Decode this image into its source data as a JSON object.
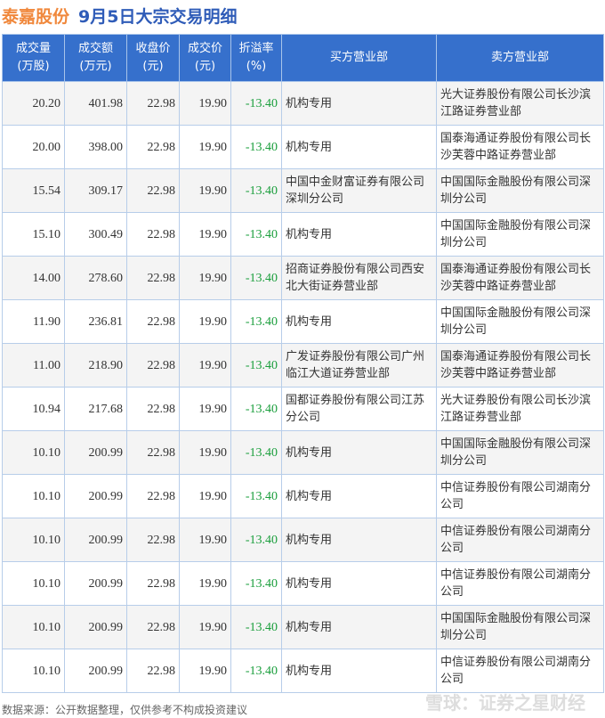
{
  "title": {
    "stock": "泰嘉股份",
    "desc": "9月5日大宗交易明细"
  },
  "headers": [
    "成交量\n(万股)",
    "成交额\n(万元)",
    "收盘价\n(元)",
    "成交价\n(元)",
    "折溢率\n(%)",
    "买方营业部",
    "卖方营业部"
  ],
  "colors": {
    "header": "#3670cc",
    "discount": "#1a9e3c",
    "stock": "#f0883c",
    "title": "#2f5cb8"
  },
  "rows": [
    [
      "20.20",
      "401.98",
      "22.98",
      "19.90",
      "-13.40",
      "机构专用",
      "光大证券股份有限公司长沙滨江路证券营业部"
    ],
    [
      "20.00",
      "398.00",
      "22.98",
      "19.90",
      "-13.40",
      "机构专用",
      "国泰海通证券股份有限公司长沙芙蓉中路证券营业部"
    ],
    [
      "15.54",
      "309.17",
      "22.98",
      "19.90",
      "-13.40",
      "中国中金财富证券有限公司深圳分公司",
      "中国国际金融股份有限公司深圳分公司"
    ],
    [
      "15.10",
      "300.49",
      "22.98",
      "19.90",
      "-13.40",
      "机构专用",
      "中国国际金融股份有限公司深圳分公司"
    ],
    [
      "14.00",
      "278.60",
      "22.98",
      "19.90",
      "-13.40",
      "招商证券股份有限公司西安北大街证券营业部",
      "国泰海通证券股份有限公司长沙芙蓉中路证券营业部"
    ],
    [
      "11.90",
      "236.81",
      "22.98",
      "19.90",
      "-13.40",
      "机构专用",
      "中国国际金融股份有限公司深圳分公司"
    ],
    [
      "11.00",
      "218.90",
      "22.98",
      "19.90",
      "-13.40",
      "广发证券股份有限公司广州临江大道证券营业部",
      "国泰海通证券股份有限公司长沙芙蓉中路证券营业部"
    ],
    [
      "10.94",
      "217.68",
      "22.98",
      "19.90",
      "-13.40",
      "国都证券股份有限公司江苏分公司",
      "光大证券股份有限公司长沙滨江路证券营业部"
    ],
    [
      "10.10",
      "200.99",
      "22.98",
      "19.90",
      "-13.40",
      "机构专用",
      "中国国际金融股份有限公司深圳分公司"
    ],
    [
      "10.10",
      "200.99",
      "22.98",
      "19.90",
      "-13.40",
      "机构专用",
      "中信证券股份有限公司湖南分公司"
    ],
    [
      "10.10",
      "200.99",
      "22.98",
      "19.90",
      "-13.40",
      "机构专用",
      "中信证券股份有限公司湖南分公司"
    ],
    [
      "10.10",
      "200.99",
      "22.98",
      "19.90",
      "-13.40",
      "机构专用",
      "中信证券股份有限公司湖南分公司"
    ],
    [
      "10.10",
      "200.99",
      "22.98",
      "19.90",
      "-13.40",
      "机构专用",
      "中国国际金融股份有限公司深圳分公司"
    ],
    [
      "10.10",
      "200.99",
      "22.98",
      "19.90",
      "-13.40",
      "机构专用",
      "中信证券股份有限公司湖南分公司"
    ]
  ],
  "footer": "数据来源：公开数据整理，仅供参考不构成投资建议",
  "watermark": "雪球：证券之星财经"
}
